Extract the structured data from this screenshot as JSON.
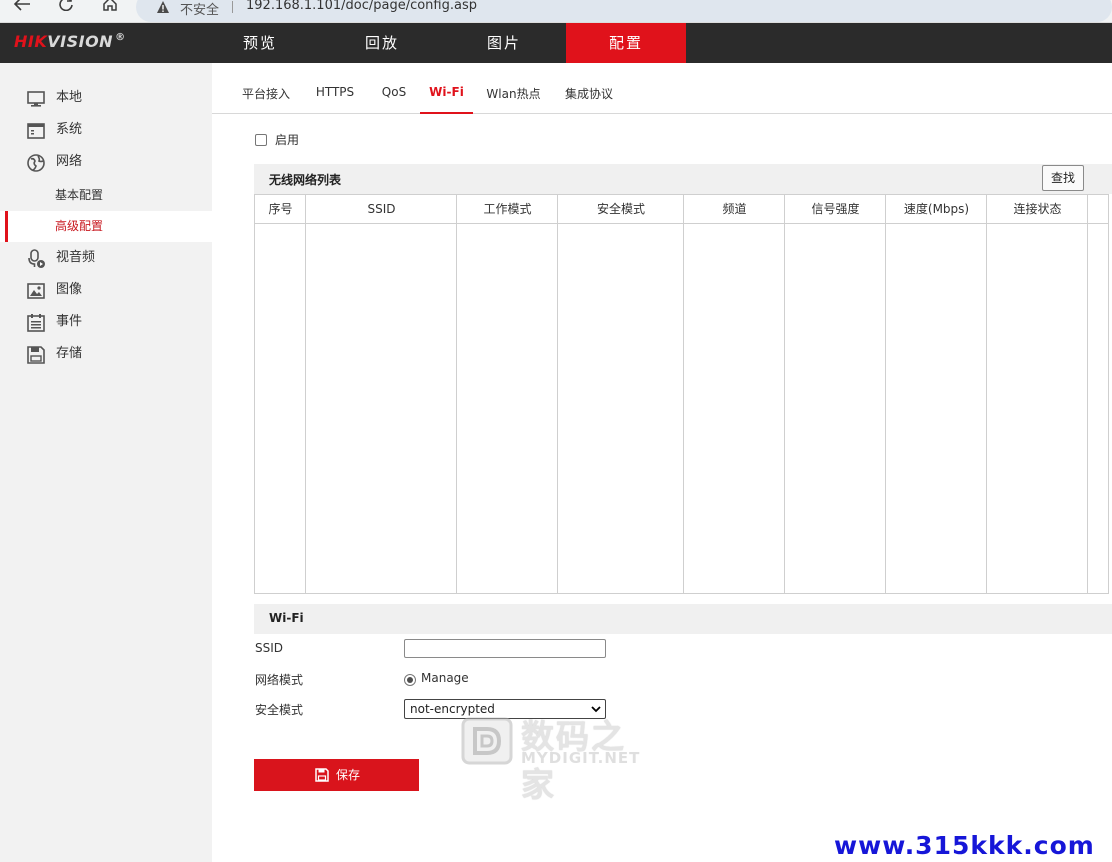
{
  "browser": {
    "insecure_label": "不安全",
    "url": "192.168.1.101/doc/page/config.asp"
  },
  "header": {
    "logo_hik": "HIK",
    "logo_vision": "VISION",
    "logo_reg": "®",
    "nav": [
      "预览",
      "回放",
      "图片",
      "配置"
    ],
    "active_nav": "配置"
  },
  "sidebar": {
    "items": [
      {
        "label": "本地",
        "icon": "monitor-icon"
      },
      {
        "label": "系统",
        "icon": "system-icon"
      },
      {
        "label": "网络",
        "icon": "globe-icon"
      },
      {
        "label": "视音频",
        "icon": "microphone-icon"
      },
      {
        "label": "图像",
        "icon": "image-icon"
      },
      {
        "label": "事件",
        "icon": "calendar-icon"
      },
      {
        "label": "存储",
        "icon": "floppy-icon"
      }
    ],
    "network_sub": [
      "基本配置",
      "高级配置"
    ],
    "active_sub": "高级配置"
  },
  "tabs": [
    "平台接入",
    "HTTPS",
    "QoS",
    "Wi-Fi",
    "Wlan热点",
    "集成协议"
  ],
  "active_tab": "Wi-Fi",
  "enable_label": "启用",
  "wlan_list": {
    "title": "无线网络列表",
    "search_label": "查找",
    "columns": [
      "序号",
      "SSID",
      "工作模式",
      "安全模式",
      "频道",
      "信号强度",
      "速度(Mbps)",
      "连接状态"
    ],
    "rows": []
  },
  "wifi_form": {
    "title": "Wi-Fi",
    "ssid_label": "SSID",
    "ssid_value": "",
    "network_mode_label": "网络模式",
    "network_mode_value": "Manage",
    "security_mode_label": "安全模式",
    "security_mode_value": "not-encrypted"
  },
  "save_label": "保存",
  "watermarks": {
    "mydigit_cn": "数码之家",
    "mydigit_en": "MYDIGIT.NET",
    "site": "www.315kkk.com"
  },
  "colors": {
    "accent_red": "#e0121b",
    "header_bg": "#2b2b2b",
    "sidebar_bg": "#f2f2f2"
  }
}
